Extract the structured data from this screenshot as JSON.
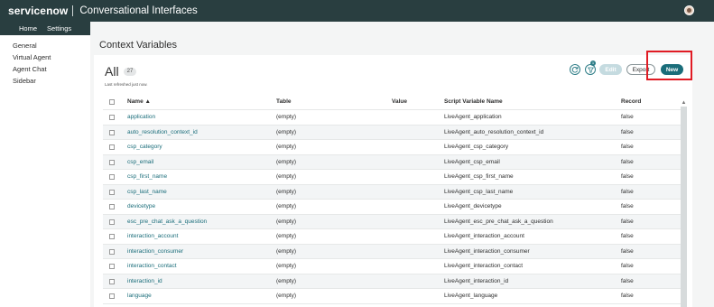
{
  "header": {
    "brand": "servicenow",
    "app_title": "Conversational Interfaces"
  },
  "nav": {
    "tabs": [
      "Home",
      "Settings"
    ]
  },
  "sidebar": {
    "items": [
      "General",
      "Virtual Agent",
      "Agent Chat",
      "Sidebar"
    ]
  },
  "page": {
    "title": "Context Variables"
  },
  "list": {
    "title": "All",
    "count": "27",
    "refreshed": "Last refreshed just now.",
    "filter_badge": "1",
    "buttons": {
      "edit": "Edit",
      "export": "Export",
      "new": "New"
    },
    "columns": [
      "Name ▲",
      "Table",
      "Value",
      "Script Variable Name",
      "Record"
    ],
    "rows": [
      {
        "name": "application",
        "table": "(empty)",
        "value": "",
        "script": "LiveAgent_application",
        "record": "false"
      },
      {
        "name": "auto_resolution_context_id",
        "table": "(empty)",
        "value": "",
        "script": "LiveAgent_auto_resolution_context_id",
        "record": "false"
      },
      {
        "name": "csp_category",
        "table": "(empty)",
        "value": "",
        "script": "LiveAgent_csp_category",
        "record": "false"
      },
      {
        "name": "csp_email",
        "table": "(empty)",
        "value": "",
        "script": "LiveAgent_csp_email",
        "record": "false"
      },
      {
        "name": "csp_first_name",
        "table": "(empty)",
        "value": "",
        "script": "LiveAgent_csp_first_name",
        "record": "false"
      },
      {
        "name": "csp_last_name",
        "table": "(empty)",
        "value": "",
        "script": "LiveAgent_csp_last_name",
        "record": "false"
      },
      {
        "name": "devicetype",
        "table": "(empty)",
        "value": "",
        "script": "LiveAgent_devicetype",
        "record": "false"
      },
      {
        "name": "esc_pre_chat_ask_a_question",
        "table": "(empty)",
        "value": "",
        "script": "LiveAgent_esc_pre_chat_ask_a_question",
        "record": "false"
      },
      {
        "name": "interaction_account",
        "table": "(empty)",
        "value": "",
        "script": "LiveAgent_interaction_account",
        "record": "false"
      },
      {
        "name": "interaction_consumer",
        "table": "(empty)",
        "value": "",
        "script": "LiveAgent_interaction_consumer",
        "record": "false"
      },
      {
        "name": "interaction_contact",
        "table": "(empty)",
        "value": "",
        "script": "LiveAgent_interaction_contact",
        "record": "false"
      },
      {
        "name": "interaction_id",
        "table": "(empty)",
        "value": "",
        "script": "LiveAgent_interaction_id",
        "record": "false"
      },
      {
        "name": "language",
        "table": "(empty)",
        "value": "",
        "script": "LiveAgent_language",
        "record": "false"
      }
    ]
  },
  "colors": {
    "header_bg": "#293e40",
    "accent": "#1a6d7a",
    "highlight": "#e01b24"
  }
}
